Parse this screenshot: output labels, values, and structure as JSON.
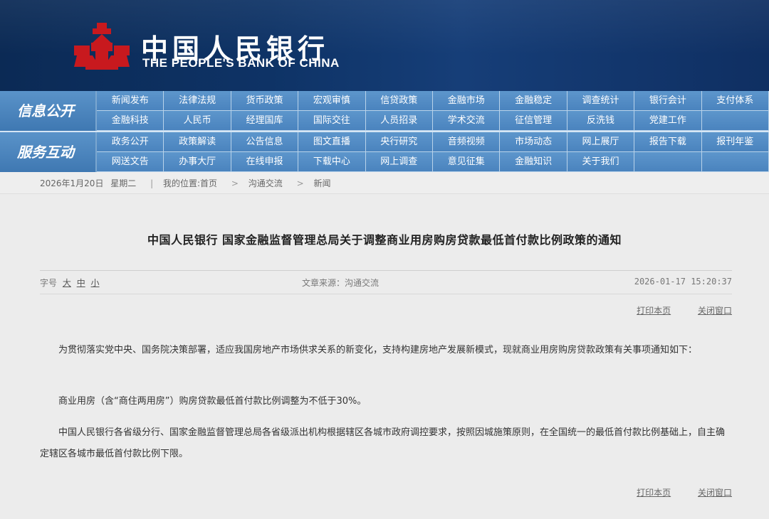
{
  "header": {
    "logo_cn": "中国人民银行",
    "logo_en": "THE PEOPLE'S BANK OF CHINA",
    "logo_icon": "pbc-emblem-icon",
    "colors": {
      "bg": "#0e3366",
      "emblem": "#c8191e"
    }
  },
  "nav": {
    "band1_label": "信息公开",
    "band1_items": [
      "新闻发布",
      "法律法规",
      "货币政策",
      "宏观审慎",
      "信贷政策",
      "金融市场",
      "金融稳定",
      "调查统计",
      "银行会计",
      "支付体系",
      "金融科技",
      "人民币",
      "经理国库",
      "国际交往",
      "人员招录",
      "学术交流",
      "征信管理",
      "反洗钱",
      "党建工作",
      ""
    ],
    "band2_label": "服务互动",
    "band2_items": [
      "政务公开",
      "政策解读",
      "公告信息",
      "图文直播",
      "央行研究",
      "音频视频",
      "市场动态",
      "网上展厅",
      "报告下载",
      "报刊年鉴",
      "网送文告",
      "办事大厅",
      "在线申报",
      "下载中心",
      "网上调查",
      "意见征集",
      "金融知识",
      "关于我们",
      "",
      ""
    ]
  },
  "breadcrumb": {
    "date": "2026年1月20日",
    "weekday": "星期二",
    "prefix": "我的位置:",
    "home": "首页",
    "level1": "沟通交流",
    "level2": "新闻"
  },
  "article": {
    "title": "中国人民银行 国家金融监督管理总局关于调整商业用房购房贷款最低首付款比例政策的通知",
    "fontsize_label": "字号",
    "fontsize_large": "大",
    "fontsize_medium": "中",
    "fontsize_small": "小",
    "source": "文章来源：沟通交流",
    "datetime": "2026-01-17 15:20:37",
    "print_label": "打印本页",
    "close_label": "关闭窗口",
    "paragraphs": [
      "为贯彻落实党中央、国务院决策部署，适应我国房地产市场供求关系的新变化，支持构建房地产发展新模式，现就商业用房购房贷款政策有关事项通知如下：",
      "商业用房（含“商住两用房”）购房贷款最低首付款比例调整为不低于30%。",
      "中国人民银行各省级分行、国家金融监督管理总局各省级派出机构根据辖区各城市政府调控要求，按照因城施策原则，在全国统一的最低首付款比例基础上，自主确定辖区各城市最低首付款比例下限。"
    ]
  }
}
